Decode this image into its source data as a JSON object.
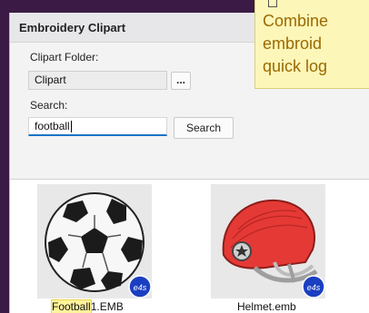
{
  "panel": {
    "title": "Embroidery Clipart",
    "folder_label": "Clipart Folder:",
    "folder_value": "Clipart",
    "browse_label": "...",
    "search_label": "Search:",
    "search_value": "football",
    "search_button": "Search"
  },
  "results": [
    {
      "name_highlight": "Football",
      "name_rest": "1.EMB",
      "image": "soccer-ball"
    },
    {
      "name_highlight": "",
      "name_rest": "Helmet.emb",
      "image": "football-helmet"
    }
  ],
  "badge_text": "e4s",
  "tooltip": {
    "lines": [
      "Combine",
      "embroid",
      "quick log"
    ]
  }
}
